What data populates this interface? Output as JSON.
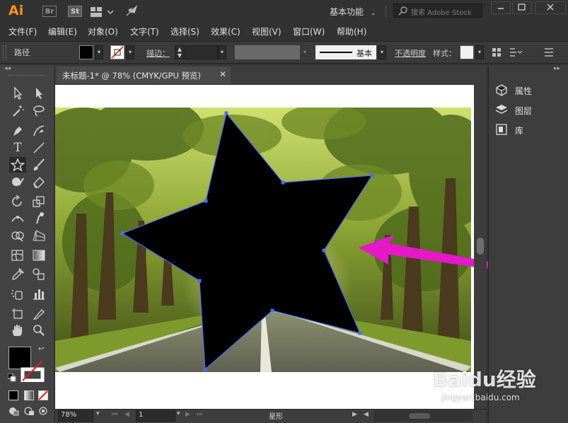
{
  "app": {
    "logo": "Ai",
    "bridge_label": "Br",
    "stock_label": "St",
    "workspace": "基本功能",
    "search_placeholder": "搜索 Adobe Stock"
  },
  "menu": [
    "文件(F)",
    "编辑(E)",
    "对象(O)",
    "文字(T)",
    "选择(S)",
    "效果(C)",
    "视图(V)",
    "窗口(W)",
    "帮助(H)"
  ],
  "control": {
    "selection_label": "路径",
    "stroke_label": "描边：",
    "brush_label": "基本",
    "opacity_label": "不透明度",
    "style_label": "样式："
  },
  "document": {
    "tab_title": "未标题-1* @ 78% (CMYK/GPU 预览)"
  },
  "panels": [
    "属性",
    "图层",
    "库"
  ],
  "status": {
    "zoom": "78%",
    "artboard": "1",
    "selection_tool": "星形"
  },
  "watermark": {
    "brand": "Baidu经验",
    "url": "jingyan.baidu.com"
  },
  "colors": {
    "accent_logo": "#f7931e",
    "selection_blue": "#4a6cf7",
    "arrow_magenta": "#e619c8"
  }
}
